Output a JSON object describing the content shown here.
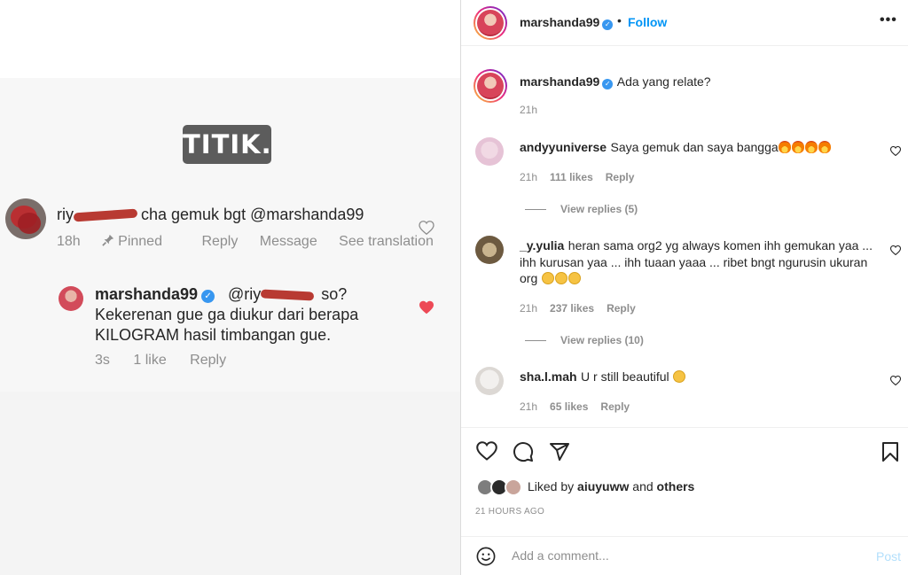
{
  "image": {
    "stamp_text": "TITIK.",
    "comment1": {
      "user_visible": "riy",
      "text": "cha gemuk bgt @marshanda99",
      "time": "18h",
      "pinned": "Pinned",
      "reply": "Reply",
      "message": "Message",
      "see_translation": "See translation"
    },
    "comment2": {
      "user": "marshanda99",
      "mention_visible": "@riy",
      "line1_end": "so?",
      "line2": "Kekerenan gue ga diukur dari berapa",
      "line3": "KILOGRAM hasil timbangan gue.",
      "time": "3s",
      "likes": "1 like",
      "reply": "Reply"
    }
  },
  "header": {
    "username": "marshanda99",
    "dot": "•",
    "follow": "Follow",
    "more": "•••"
  },
  "caption": {
    "username": "marshanda99",
    "text": "Ada yang relate?",
    "time": "21h"
  },
  "comments": [
    {
      "username": "andyyuniverse",
      "text": "Saya gemuk dan saya bangga",
      "time": "21h",
      "likes": "111 likes",
      "reply": "Reply",
      "view_replies": "View replies (5)"
    },
    {
      "username": "_y.yulia",
      "line1": "heran sama org2 yg always komen ihh gemukan yaa ...",
      "line2": "ihh kurusan yaa ... ihh tuaan yaaa ... ribet bngt ngurusin ukuran",
      "line3": "org",
      "time": "21h",
      "likes": "237 likes",
      "reply": "Reply",
      "view_replies": "View replies (10)"
    },
    {
      "username": "sha.l.mah",
      "text": "U r still beautiful",
      "time": "21h",
      "likes": "65 likes",
      "reply": "Reply"
    }
  ],
  "likes": {
    "prefix": "Liked by",
    "user": "aiuyuww",
    "and": "and",
    "others": "others"
  },
  "time_ago": "21 HOURS AGO",
  "add_comment": {
    "placeholder": "Add a comment...",
    "post": "Post"
  },
  "colors": {
    "accent": "#0095f6",
    "verified": "#3897f0",
    "like_red": "#ed4956",
    "muted": "#8e8e8e"
  }
}
